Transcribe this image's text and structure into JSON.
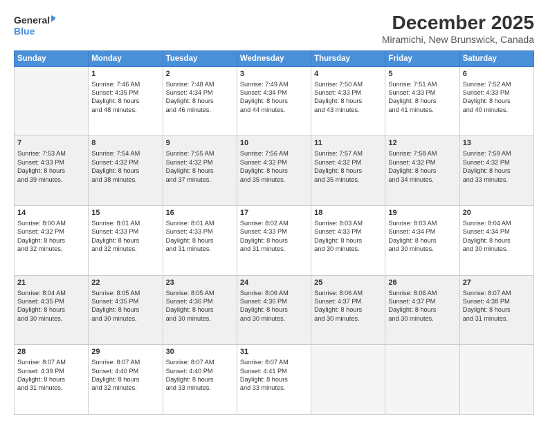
{
  "logo": {
    "line1": "General",
    "line2": "Blue"
  },
  "title": "December 2025",
  "subtitle": "Miramichi, New Brunswick, Canada",
  "days_header": [
    "Sunday",
    "Monday",
    "Tuesday",
    "Wednesday",
    "Thursday",
    "Friday",
    "Saturday"
  ],
  "weeks": [
    [
      {
        "day": "",
        "info": ""
      },
      {
        "day": "1",
        "info": "Sunrise: 7:46 AM\nSunset: 4:35 PM\nDaylight: 8 hours\nand 48 minutes."
      },
      {
        "day": "2",
        "info": "Sunrise: 7:48 AM\nSunset: 4:34 PM\nDaylight: 8 hours\nand 46 minutes."
      },
      {
        "day": "3",
        "info": "Sunrise: 7:49 AM\nSunset: 4:34 PM\nDaylight: 8 hours\nand 44 minutes."
      },
      {
        "day": "4",
        "info": "Sunrise: 7:50 AM\nSunset: 4:33 PM\nDaylight: 8 hours\nand 43 minutes."
      },
      {
        "day": "5",
        "info": "Sunrise: 7:51 AM\nSunset: 4:33 PM\nDaylight: 8 hours\nand 41 minutes."
      },
      {
        "day": "6",
        "info": "Sunrise: 7:52 AM\nSunset: 4:33 PM\nDaylight: 8 hours\nand 40 minutes."
      }
    ],
    [
      {
        "day": "7",
        "info": "Sunrise: 7:53 AM\nSunset: 4:33 PM\nDaylight: 8 hours\nand 39 minutes."
      },
      {
        "day": "8",
        "info": "Sunrise: 7:54 AM\nSunset: 4:32 PM\nDaylight: 8 hours\nand 38 minutes."
      },
      {
        "day": "9",
        "info": "Sunrise: 7:55 AM\nSunset: 4:32 PM\nDaylight: 8 hours\nand 37 minutes."
      },
      {
        "day": "10",
        "info": "Sunrise: 7:56 AM\nSunset: 4:32 PM\nDaylight: 8 hours\nand 35 minutes."
      },
      {
        "day": "11",
        "info": "Sunrise: 7:57 AM\nSunset: 4:32 PM\nDaylight: 8 hours\nand 35 minutes."
      },
      {
        "day": "12",
        "info": "Sunrise: 7:58 AM\nSunset: 4:32 PM\nDaylight: 8 hours\nand 34 minutes."
      },
      {
        "day": "13",
        "info": "Sunrise: 7:59 AM\nSunset: 4:32 PM\nDaylight: 8 hours\nand 33 minutes."
      }
    ],
    [
      {
        "day": "14",
        "info": "Sunrise: 8:00 AM\nSunset: 4:32 PM\nDaylight: 8 hours\nand 32 minutes."
      },
      {
        "day": "15",
        "info": "Sunrise: 8:01 AM\nSunset: 4:33 PM\nDaylight: 8 hours\nand 32 minutes."
      },
      {
        "day": "16",
        "info": "Sunrise: 8:01 AM\nSunset: 4:33 PM\nDaylight: 8 hours\nand 31 minutes."
      },
      {
        "day": "17",
        "info": "Sunrise: 8:02 AM\nSunset: 4:33 PM\nDaylight: 8 hours\nand 31 minutes."
      },
      {
        "day": "18",
        "info": "Sunrise: 8:03 AM\nSunset: 4:33 PM\nDaylight: 8 hours\nand 30 minutes."
      },
      {
        "day": "19",
        "info": "Sunrise: 8:03 AM\nSunset: 4:34 PM\nDaylight: 8 hours\nand 30 minutes."
      },
      {
        "day": "20",
        "info": "Sunrise: 8:04 AM\nSunset: 4:34 PM\nDaylight: 8 hours\nand 30 minutes."
      }
    ],
    [
      {
        "day": "21",
        "info": "Sunrise: 8:04 AM\nSunset: 4:35 PM\nDaylight: 8 hours\nand 30 minutes."
      },
      {
        "day": "22",
        "info": "Sunrise: 8:05 AM\nSunset: 4:35 PM\nDaylight: 8 hours\nand 30 minutes."
      },
      {
        "day": "23",
        "info": "Sunrise: 8:05 AM\nSunset: 4:36 PM\nDaylight: 8 hours\nand 30 minutes."
      },
      {
        "day": "24",
        "info": "Sunrise: 8:06 AM\nSunset: 4:36 PM\nDaylight: 8 hours\nand 30 minutes."
      },
      {
        "day": "25",
        "info": "Sunrise: 8:06 AM\nSunset: 4:37 PM\nDaylight: 8 hours\nand 30 minutes."
      },
      {
        "day": "26",
        "info": "Sunrise: 8:06 AM\nSunset: 4:37 PM\nDaylight: 8 hours\nand 30 minutes."
      },
      {
        "day": "27",
        "info": "Sunrise: 8:07 AM\nSunset: 4:38 PM\nDaylight: 8 hours\nand 31 minutes."
      }
    ],
    [
      {
        "day": "28",
        "info": "Sunrise: 8:07 AM\nSunset: 4:39 PM\nDaylight: 8 hours\nand 31 minutes."
      },
      {
        "day": "29",
        "info": "Sunrise: 8:07 AM\nSunset: 4:40 PM\nDaylight: 8 hours\nand 32 minutes."
      },
      {
        "day": "30",
        "info": "Sunrise: 8:07 AM\nSunset: 4:40 PM\nDaylight: 8 hours\nand 33 minutes."
      },
      {
        "day": "31",
        "info": "Sunrise: 8:07 AM\nSunset: 4:41 PM\nDaylight: 8 hours\nand 33 minutes."
      },
      {
        "day": "",
        "info": ""
      },
      {
        "day": "",
        "info": ""
      },
      {
        "day": "",
        "info": ""
      }
    ]
  ]
}
